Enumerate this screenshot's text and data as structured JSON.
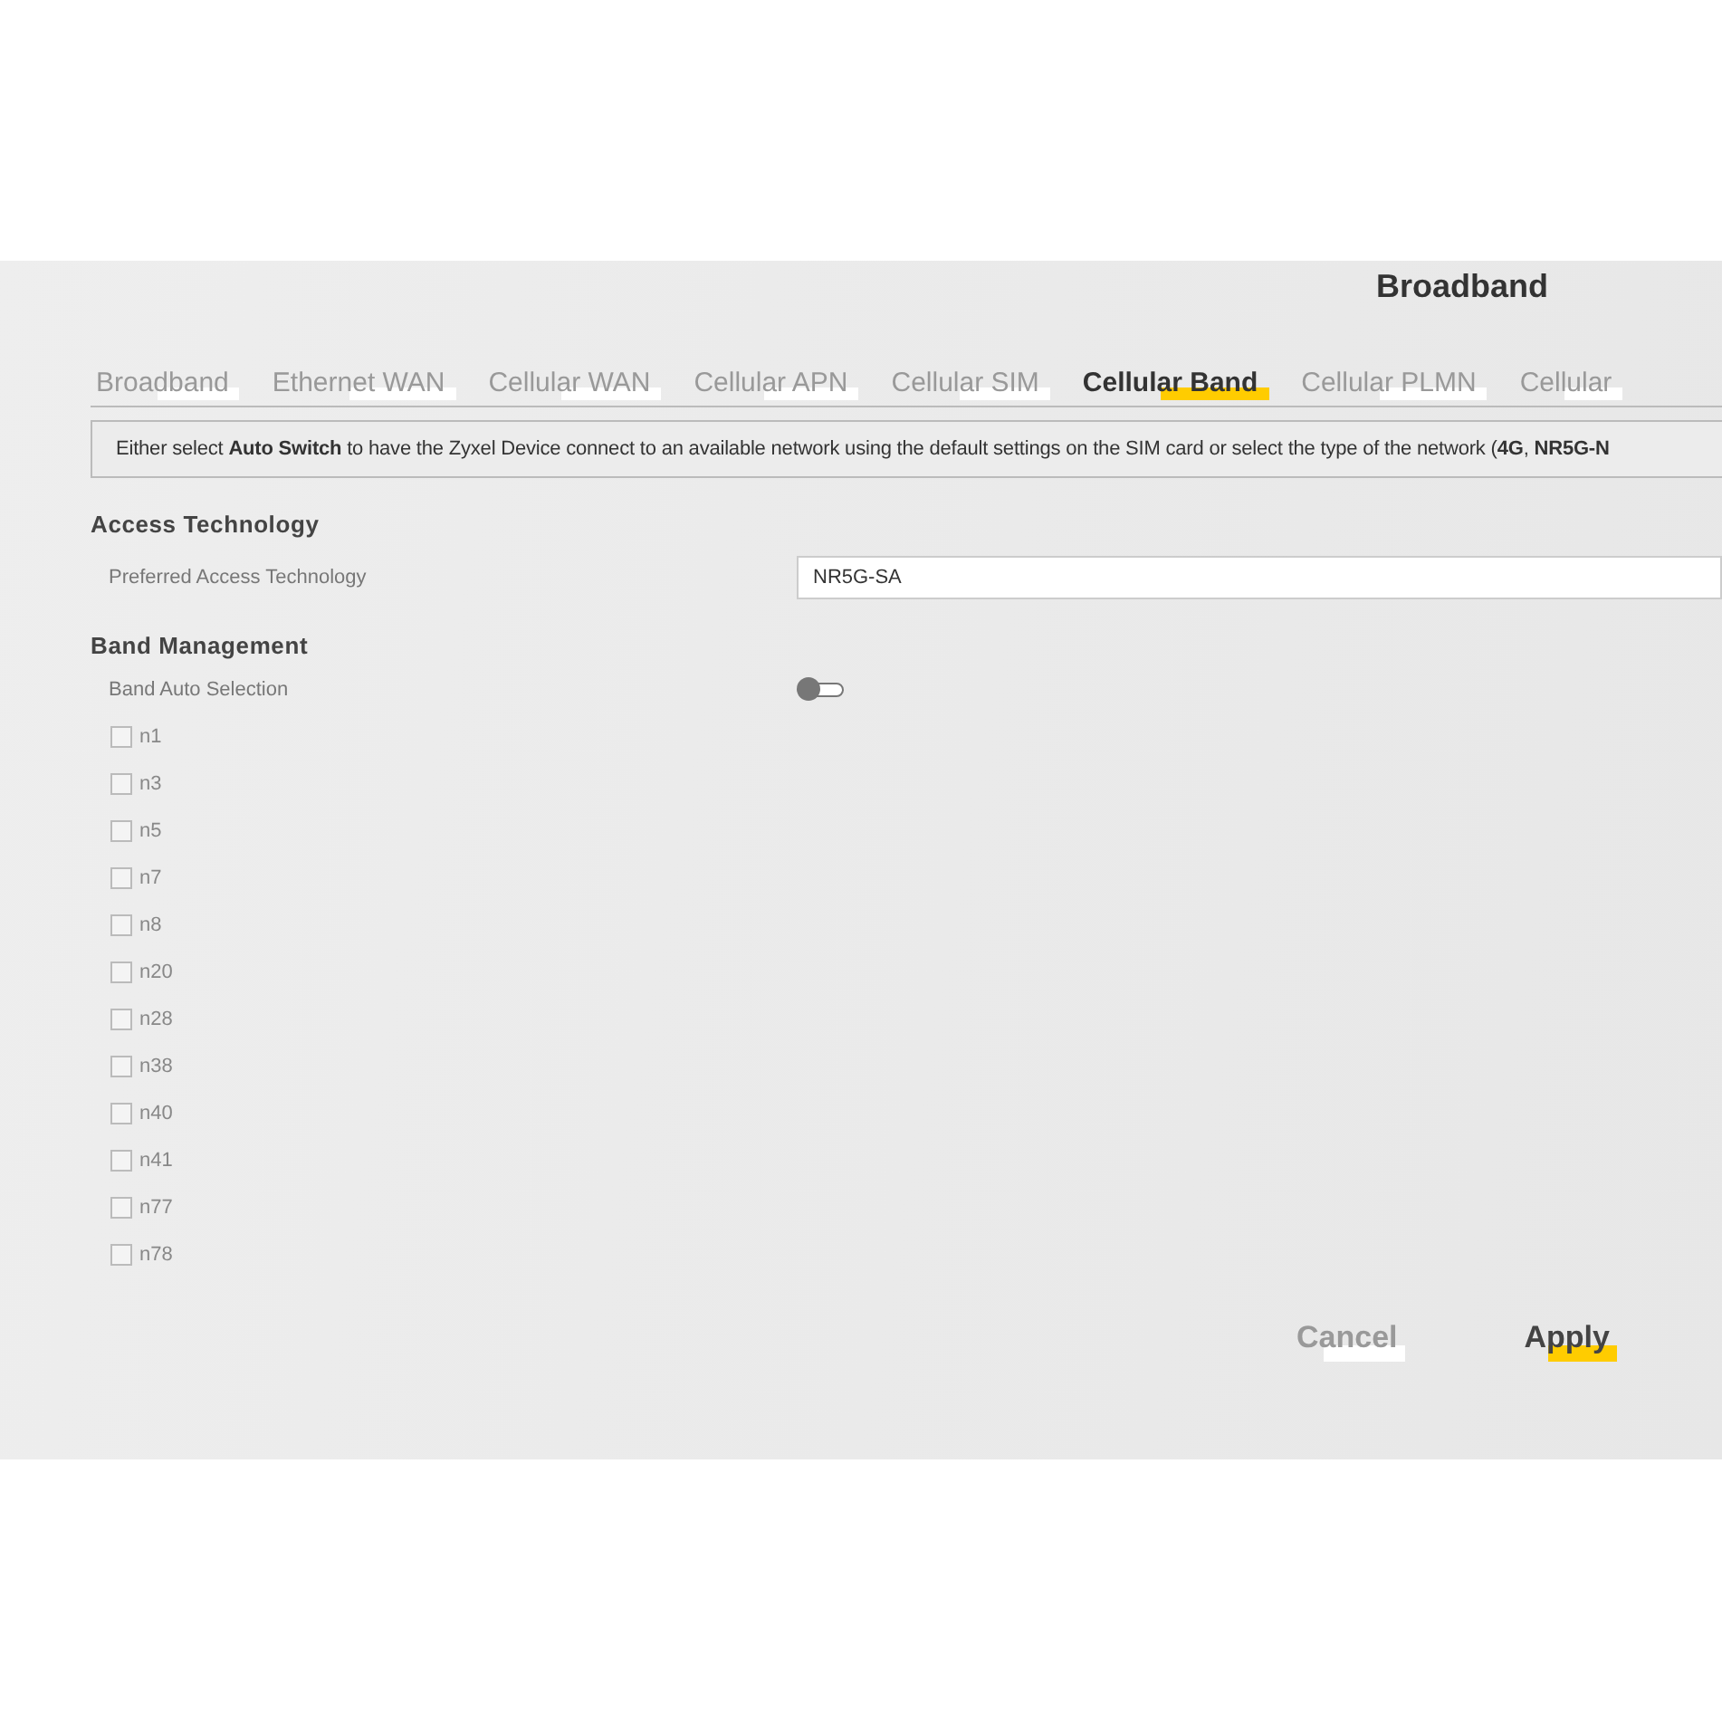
{
  "page_title": "Broadband",
  "tabs": [
    {
      "label": "Broadband",
      "selected": false
    },
    {
      "label": "Ethernet WAN",
      "selected": false
    },
    {
      "label": "Cellular WAN",
      "selected": false
    },
    {
      "label": "Cellular APN",
      "selected": false
    },
    {
      "label": "Cellular SIM",
      "selected": false
    },
    {
      "label": "Cellular Band",
      "selected": true
    },
    {
      "label": "Cellular PLMN",
      "selected": false
    },
    {
      "label": "Cellular",
      "selected": false
    }
  ],
  "info": "Either select **Auto Switch** to have the Zyxel Device connect to an available network using the default settings on the SIM card or select the type of the network (**4G**, **NR5G-N**",
  "access_technology": {
    "heading": "Access Technology",
    "label": "Preferred Access Technology",
    "value": "NR5G-SA"
  },
  "band_management": {
    "heading": "Band Management",
    "auto_label": "Band Auto Selection",
    "auto_on": false,
    "bands": [
      {
        "label": "n1",
        "checked": false
      },
      {
        "label": "n3",
        "checked": false
      },
      {
        "label": "n5",
        "checked": false
      },
      {
        "label": "n7",
        "checked": false
      },
      {
        "label": "n8",
        "checked": false
      },
      {
        "label": "n20",
        "checked": false
      },
      {
        "label": "n28",
        "checked": false
      },
      {
        "label": "n38",
        "checked": false
      },
      {
        "label": "n40",
        "checked": false
      },
      {
        "label": "n41",
        "checked": false
      },
      {
        "label": "n77",
        "checked": false
      },
      {
        "label": "n78",
        "checked": false
      }
    ]
  },
  "buttons": [
    {
      "label": "Cancel",
      "kind": "secondary"
    },
    {
      "label": "Apply",
      "kind": "primary"
    }
  ]
}
